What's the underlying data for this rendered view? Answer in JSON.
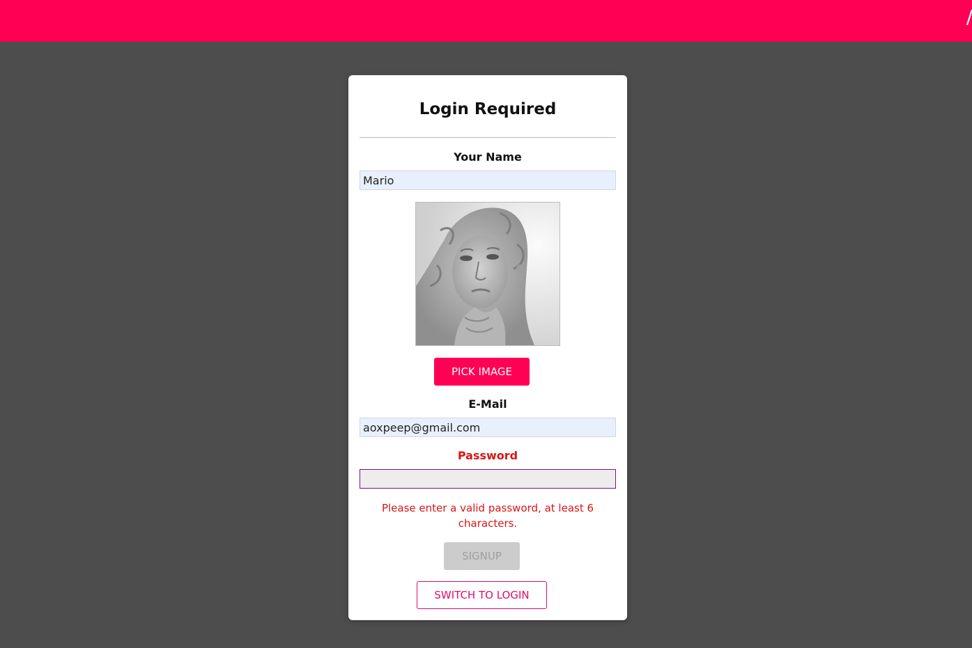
{
  "colors": {
    "primary": "#ff0055",
    "page_background": "#4d4d4d",
    "error": "#d91616",
    "autofill_background": "#e8f0fe"
  },
  "form": {
    "title": "Login Required",
    "name_label": "Your Name",
    "name_value": "Mario",
    "pick_image_label": "PICK IMAGE",
    "email_label": "E-Mail",
    "email_value": "aoxpeep@gmail.com",
    "password_label": "Password",
    "password_value": "",
    "password_error": "Please enter a valid password, at least 6 characters.",
    "signup_label": "SIGNUP",
    "switch_label": "SWITCH TO LOGIN"
  },
  "image_preview": {
    "icon": "user-photo-preview"
  }
}
